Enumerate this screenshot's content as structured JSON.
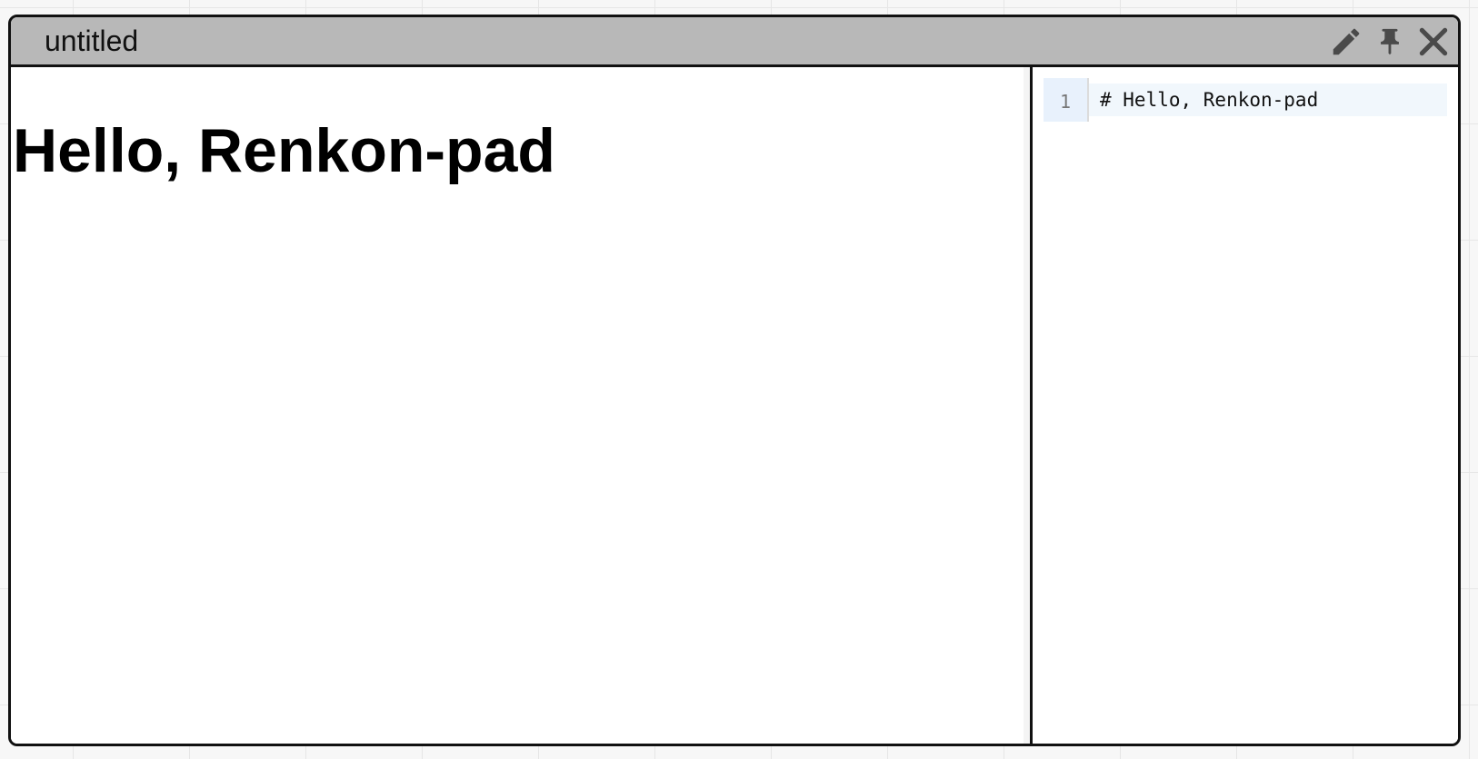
{
  "window": {
    "title": "untitled"
  },
  "toolbar": {
    "icons": [
      "pencil-icon",
      "pin-icon",
      "close-icon"
    ]
  },
  "preview": {
    "heading": "Hello, Renkon-pad"
  },
  "editor": {
    "lines": [
      {
        "number": "1",
        "text": "# Hello, Renkon-pad"
      }
    ]
  },
  "colors": {
    "titlebar": "#b8b8b8",
    "border": "#111111",
    "gutter": "#e8f1fc",
    "active_line": "#f1f7fc",
    "icon": "#4a4a4a"
  }
}
